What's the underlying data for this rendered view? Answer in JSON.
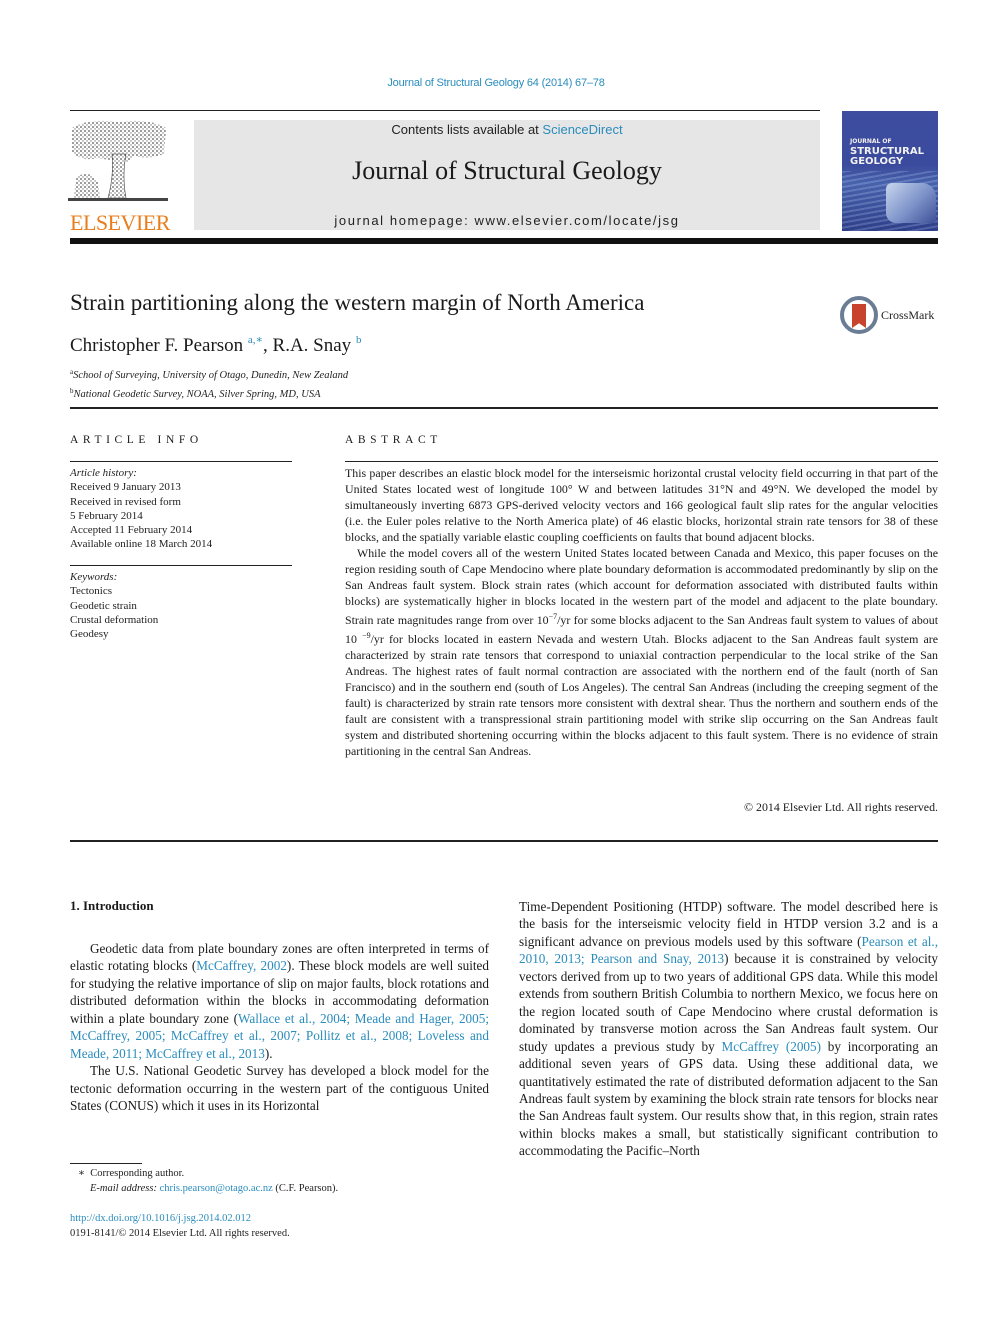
{
  "citation_header": "Journal of Structural Geology 64 (2014) 67–78",
  "masthead": {
    "contents_prefix": "Contents lists available at ",
    "contents_link": "ScienceDirect",
    "journal_name": "Journal of Structural Geology",
    "homepage": "journal homepage: www.elsevier.com/locate/jsg",
    "publisher_logo_text": "ELSEVIER",
    "cover": {
      "line1": "JOURNAL OF",
      "line2": "STRUCTURAL",
      "line3": "GEOLOGY"
    },
    "colors": {
      "link_blue": "#2a8cbc",
      "elsevier_orange": "#e87e1c",
      "masthead_gray": "#e6e6e6"
    }
  },
  "article": {
    "title": "Strain partitioning along the western margin of North America",
    "crossmark_label": "CrossMark",
    "authors": [
      {
        "name": "Christopher F. Pearson",
        "marks": "a,∗"
      },
      {
        "name": "R.A. Snay",
        "marks": "b"
      }
    ],
    "author_separator": ", ",
    "affiliations": [
      {
        "mark": "a",
        "text": "School of Surveying, University of Otago, Dunedin, New Zealand"
      },
      {
        "mark": "b",
        "text": "National Geodetic Survey, NOAA, Silver Spring, MD, USA"
      }
    ]
  },
  "article_info": {
    "heading": "ARTICLE INFO",
    "history_label": "Article history:",
    "history": [
      "Received 9 January 2013",
      "Received in revised form",
      "5 February 2014",
      "Accepted 11 February 2014",
      "Available online 18 March 2014"
    ],
    "keywords_label": "Keywords:",
    "keywords": [
      "Tectonics",
      "Geodetic strain",
      "Crustal deformation",
      "Geodesy"
    ]
  },
  "abstract": {
    "heading": "ABSTRACT",
    "p1": "This paper describes an elastic block model for the interseismic horizontal crustal velocity field occurring in that part of the United States located west of longitude 100° W and between latitudes 31°N and 49°N. We developed the model by simultaneously inverting 6873 GPS-derived velocity vectors and 166 geological fault slip rates for the angular velocities (i.e. the Euler poles relative to the North America plate) of 46 elastic blocks, horizontal strain rate tensors for 38 of these blocks, and the spatially variable elastic coupling coefficients on faults that bound adjacent blocks.",
    "p2_a": "While the model covers all of the western United States located between Canada and Mexico, this paper focuses on the region residing south of Cape Mendocino where plate boundary deformation is accommodated predominantly by slip on the San Andreas fault system. Block strain rates (which account for deformation associated with distributed faults within blocks) are systematically higher in blocks located in the western part of the model and adjacent to the plate boundary. Strain rate magnitudes range from over 10",
    "p2_exp1": "−7",
    "p2_b": "/yr for some blocks adjacent to the San Andreas fault system to values of about 10 ",
    "p2_exp2": "−9",
    "p2_c": "/yr for blocks located in eastern Nevada and western Utah. Blocks adjacent to the San Andreas fault system are characterized by strain rate tensors that correspond to uniaxial contraction perpendicular to the local strike of the San Andreas. The highest rates of fault normal contraction are associated with the northern end of the fault (north of San Francisco) and in the southern end (south of Los Angeles). The central San Andreas (including the creeping segment of the fault) is characterized by strain rate tensors more consistent with dextral shear. Thus the northern and southern ends of the fault are consistent with a transpressional strain partitioning model with strike slip occurring on the San Andreas fault system and distributed shortening occurring within the blocks adjacent to this fault system. There is no evidence of strain partitioning in the central San Andreas.",
    "copyright": "© 2014 Elsevier Ltd. All rights reserved."
  },
  "introduction": {
    "heading": "1.  Introduction",
    "p1_a": "Geodetic data from plate boundary zones are often interpreted in terms of elastic rotating blocks (",
    "p1_ref1": "McCaffrey, 2002",
    "p1_b": "). These block models are well suited for studying the relative importance of slip on major faults, block rotations and distributed deformation within the blocks in accommodating deformation within a plate boundary zone (",
    "p1_ref2": "Wallace et al., 2004; Meade and Hager, 2005; McCaffrey, 2005; McCaffrey et al., 2007; Pollitz et al., 2008; Loveless and Meade, 2011; McCaffrey et al., 2013",
    "p1_c": ").",
    "p2_left": "The U.S. National Geodetic Survey has developed a block model for the tectonic deformation occurring in the western part of the contiguous United States (CONUS) which it uses in its Horizontal",
    "p2_right_a": "Time-Dependent Positioning (HTDP) software. The model described here is the basis for the interseismic velocity field in HTDP version 3.2 and is a significant advance on previous models used by this software (",
    "p2_ref1": "Pearson et al., 2010, 2013; Pearson and Snay, 2013",
    "p2_right_b": ") because it is constrained by velocity vectors derived from up to two years of additional GPS data. While this model extends from southern British Columbia to northern Mexico, we focus here on the region located south of Cape Mendocino where crustal deformation is dominated by transverse motion across the San Andreas fault system. Our study updates a previous study by ",
    "p2_ref2": "McCaffrey (2005)",
    "p2_right_c": " by incorporating an additional seven years of GPS data. Using these additional data, we quantitatively estimated the rate of distributed deformation adjacent to the San Andreas fault system by examining the block strain rate tensors for blocks near the San Andreas fault system. Our results show that, in this region, strain rates within blocks makes a small, but statistically significant contribution to accommodating the Pacific–North"
  },
  "footnotes": {
    "corresponding_mark": "∗",
    "corresponding_text": "Corresponding author.",
    "email_label": "E-mail address:",
    "email": "chris.pearson@otago.ac.nz",
    "email_suffix": " (C.F. Pearson).",
    "doi": "http://dx.doi.org/10.1016/j.jsg.2014.02.012",
    "issn_line": "0191-8141/© 2014 Elsevier Ltd. All rights reserved."
  }
}
